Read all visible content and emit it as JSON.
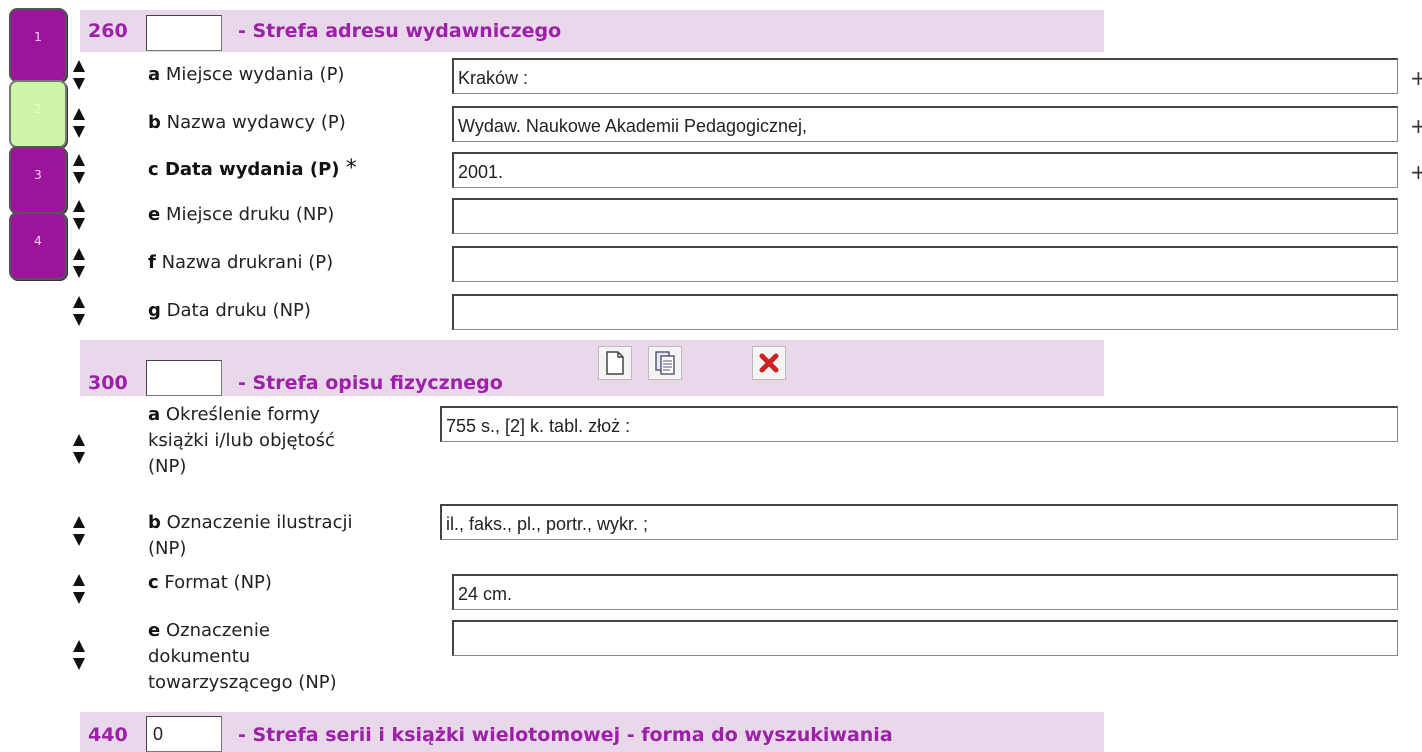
{
  "tabs": [
    {
      "label": "1",
      "active": false
    },
    {
      "label": "2",
      "active": true
    },
    {
      "label": "3",
      "active": false
    },
    {
      "label": "4",
      "active": false
    }
  ],
  "sections": [
    {
      "number": "260",
      "indicator": "",
      "title": "- Strefa adresu wydawniczego",
      "fields": [
        {
          "code": "a",
          "label": "Miejsce wydania (P)",
          "value": "Kraków :",
          "repeatable_plus": "+"
        },
        {
          "code": "b",
          "label": "Nazwa wydawcy (P)",
          "value": "Wydaw. Naukowe Akademii Pedagogicznej,",
          "repeatable_plus": "+"
        },
        {
          "code": "c",
          "label": "Data wydania (P)",
          "required_marker": "*",
          "value": "2001.",
          "repeatable_plus": "+"
        },
        {
          "code": "e",
          "label": "Miejsce druku (NP)",
          "value": ""
        },
        {
          "code": "f",
          "label": "Nazwa drukrani (P)",
          "value": ""
        },
        {
          "code": "g",
          "label": "Data druku (NP)",
          "value": ""
        }
      ]
    },
    {
      "number": "300",
      "indicator": "",
      "title": "- Strefa opisu fizycznego",
      "toolbar": [
        "new-document-icon",
        "copy-document-icon",
        "delete-icon"
      ],
      "fields": [
        {
          "code": "a",
          "label_lines": [
            "Określenie formy",
            "książki i/lub objętość",
            "(NP)"
          ],
          "value": "755 s., [2] k. tabl. złoż :"
        },
        {
          "code": "b",
          "label_lines": [
            "Oznaczenie ilustracji",
            "(NP)"
          ],
          "value": "il., faks., pl., portr., wykr. ;"
        },
        {
          "code": "c",
          "label": "Format (NP)",
          "value": "24 cm."
        },
        {
          "code": "e",
          "label_lines": [
            "Oznaczenie",
            "dokumentu",
            "towarzyszącego (NP)"
          ],
          "value": ""
        }
      ]
    },
    {
      "number": "440",
      "indicator": "0",
      "title": "- Strefa serii i książki wielotomowej - forma do wyszukiwania"
    }
  ],
  "colors": {
    "section_bg": "#e8d8ea",
    "section_text": "#9c20a8",
    "tab_purple": "#9c139c",
    "tab_active": "#ccf5a8"
  }
}
